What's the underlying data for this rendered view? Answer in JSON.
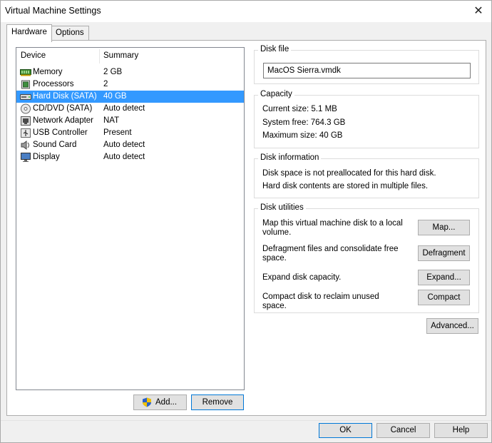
{
  "window": {
    "title": "Virtual Machine Settings"
  },
  "tabs": [
    {
      "label": "Hardware",
      "active": true
    },
    {
      "label": "Options",
      "active": false
    }
  ],
  "device_list": {
    "headers": {
      "device": "Device",
      "summary": "Summary"
    },
    "rows": [
      {
        "device": "Memory",
        "summary": "2 GB",
        "icon": "memory-icon"
      },
      {
        "device": "Processors",
        "summary": "2",
        "icon": "processor-icon"
      },
      {
        "device": "Hard Disk (SATA)",
        "summary": "40 GB",
        "icon": "hard-disk-icon",
        "selected": true
      },
      {
        "device": "CD/DVD (SATA)",
        "summary": "Auto detect",
        "icon": "cd-dvd-icon"
      },
      {
        "device": "Network Adapter",
        "summary": "NAT",
        "icon": "network-adapter-icon"
      },
      {
        "device": "USB Controller",
        "summary": "Present",
        "icon": "usb-icon"
      },
      {
        "device": "Sound Card",
        "summary": "Auto detect",
        "icon": "sound-card-icon"
      },
      {
        "device": "Display",
        "summary": "Auto detect",
        "icon": "display-icon"
      }
    ],
    "add_label": "Add...",
    "remove_label": "Remove"
  },
  "disk_file": {
    "title": "Disk file",
    "value": "MacOS Sierra.vmdk"
  },
  "capacity": {
    "title": "Capacity",
    "current_size": "Current size:  5.1 MB",
    "system_free": "System free:  764.3 GB",
    "maximum_size": "Maximum size:  40 GB"
  },
  "disk_information": {
    "title": "Disk information",
    "line1": "Disk space is not preallocated for this hard disk.",
    "line2": "Hard disk contents are stored in multiple files."
  },
  "disk_utilities": {
    "title": "Disk utilities",
    "map_text": "Map this virtual machine disk to a local volume.",
    "map_label": "Map...",
    "defrag_text": "Defragment files and consolidate free space.",
    "defrag_label": "Defragment",
    "expand_text": "Expand disk capacity.",
    "expand_label": "Expand...",
    "compact_text": "Compact disk to reclaim unused space.",
    "compact_label": "Compact"
  },
  "advanced_label": "Advanced...",
  "footer": {
    "ok_label": "OK",
    "cancel_label": "Cancel",
    "help_label": "Help"
  },
  "colors": {
    "selection": "#3399ff",
    "focus_border": "#0078d7",
    "button_face": "#e1e1e1"
  }
}
